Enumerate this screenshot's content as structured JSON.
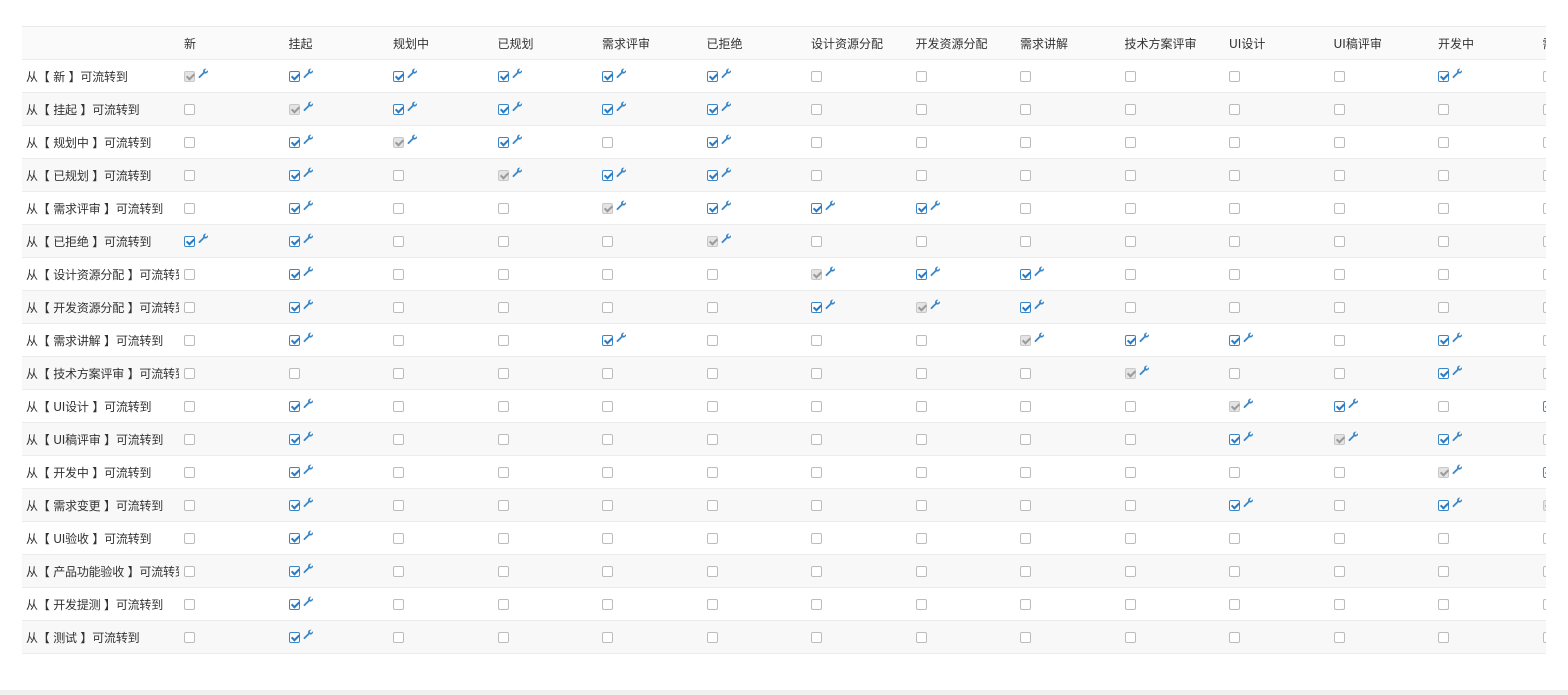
{
  "columns": [
    "新",
    "挂起",
    "规划中",
    "已规划",
    "需求评审",
    "已拒绝",
    "设计资源分配",
    "开发资源分配",
    "需求讲解",
    "技术方案评审",
    "UI设计",
    "UI稿评审",
    "开发中",
    "需"
  ],
  "rows": [
    {
      "label": "从【 新 】可流转到",
      "cells": [
        "d",
        "c",
        "c",
        "c",
        "c",
        "c",
        "u",
        "u",
        "u",
        "u",
        "u",
        "u",
        "c",
        "u"
      ]
    },
    {
      "label": "从【 挂起 】可流转到",
      "cells": [
        "u",
        "d",
        "c",
        "c",
        "c",
        "c",
        "u",
        "u",
        "u",
        "u",
        "u",
        "u",
        "u",
        "u"
      ]
    },
    {
      "label": "从【 规划中 】可流转到",
      "cells": [
        "u",
        "c",
        "d",
        "c",
        "u",
        "c",
        "u",
        "u",
        "u",
        "u",
        "u",
        "u",
        "u",
        "u"
      ]
    },
    {
      "label": "从【 已规划 】可流转到",
      "cells": [
        "u",
        "c",
        "u",
        "d",
        "c",
        "c",
        "u",
        "u",
        "u",
        "u",
        "u",
        "u",
        "u",
        "u"
      ]
    },
    {
      "label": "从【 需求评审 】可流转到",
      "cells": [
        "u",
        "c",
        "u",
        "u",
        "d",
        "c",
        "c",
        "c",
        "u",
        "u",
        "u",
        "u",
        "u",
        "u"
      ]
    },
    {
      "label": "从【 已拒绝 】可流转到",
      "cells": [
        "c",
        "c",
        "u",
        "u",
        "u",
        "d",
        "u",
        "u",
        "u",
        "u",
        "u",
        "u",
        "u",
        "u"
      ]
    },
    {
      "label": "从【 设计资源分配 】可流转到",
      "cells": [
        "u",
        "c",
        "u",
        "u",
        "u",
        "u",
        "d",
        "c",
        "c",
        "u",
        "u",
        "u",
        "u",
        "u"
      ]
    },
    {
      "label": "从【 开发资源分配 】可流转到",
      "cells": [
        "u",
        "c",
        "u",
        "u",
        "u",
        "u",
        "c",
        "d",
        "c",
        "u",
        "u",
        "u",
        "u",
        "u"
      ]
    },
    {
      "label": "从【 需求讲解 】可流转到",
      "cells": [
        "u",
        "c",
        "u",
        "u",
        "c",
        "u",
        "u",
        "u",
        "d",
        "c",
        "c",
        "u",
        "c",
        "u"
      ]
    },
    {
      "label": "从【 技术方案评审 】可流转到",
      "cells": [
        "u",
        "u",
        "u",
        "u",
        "u",
        "u",
        "u",
        "u",
        "u",
        "d",
        "u",
        "u",
        "c",
        "u"
      ]
    },
    {
      "label": "从【 UI设计 】可流转到",
      "cells": [
        "u",
        "c",
        "u",
        "u",
        "u",
        "u",
        "u",
        "u",
        "u",
        "u",
        "d",
        "c",
        "u",
        "c"
      ]
    },
    {
      "label": "从【 UI稿评审 】可流转到",
      "cells": [
        "u",
        "c",
        "u",
        "u",
        "u",
        "u",
        "u",
        "u",
        "u",
        "u",
        "c",
        "d",
        "c",
        "u"
      ]
    },
    {
      "label": "从【 开发中 】可流转到",
      "cells": [
        "u",
        "c",
        "u",
        "u",
        "u",
        "u",
        "u",
        "u",
        "u",
        "u",
        "u",
        "u",
        "d",
        "c"
      ]
    },
    {
      "label": "从【 需求变更 】可流转到",
      "cells": [
        "u",
        "c",
        "u",
        "u",
        "u",
        "u",
        "u",
        "u",
        "u",
        "u",
        "c",
        "u",
        "c",
        "d"
      ]
    },
    {
      "label": "从【 UI验收 】可流转到",
      "cells": [
        "u",
        "c",
        "u",
        "u",
        "u",
        "u",
        "u",
        "u",
        "u",
        "u",
        "u",
        "u",
        "u",
        "u"
      ]
    },
    {
      "label": "从【 产品功能验收 】可流转到",
      "cells": [
        "u",
        "c",
        "u",
        "u",
        "u",
        "u",
        "u",
        "u",
        "u",
        "u",
        "u",
        "u",
        "u",
        "u"
      ]
    },
    {
      "label": "从【 开发提测 】可流转到",
      "cells": [
        "u",
        "c",
        "u",
        "u",
        "u",
        "u",
        "u",
        "u",
        "u",
        "u",
        "u",
        "u",
        "u",
        "u"
      ]
    },
    {
      "label": "从【 测试 】可流转到",
      "cells": [
        "u",
        "c",
        "u",
        "u",
        "u",
        "u",
        "u",
        "u",
        "u",
        "u",
        "u",
        "u",
        "u",
        "u"
      ]
    }
  ],
  "colors": {
    "check": "#2a7ac4",
    "wrench": "#3a87c8",
    "disabled": "#9a9a9a"
  },
  "icons": {
    "settings": "wrench-icon"
  }
}
